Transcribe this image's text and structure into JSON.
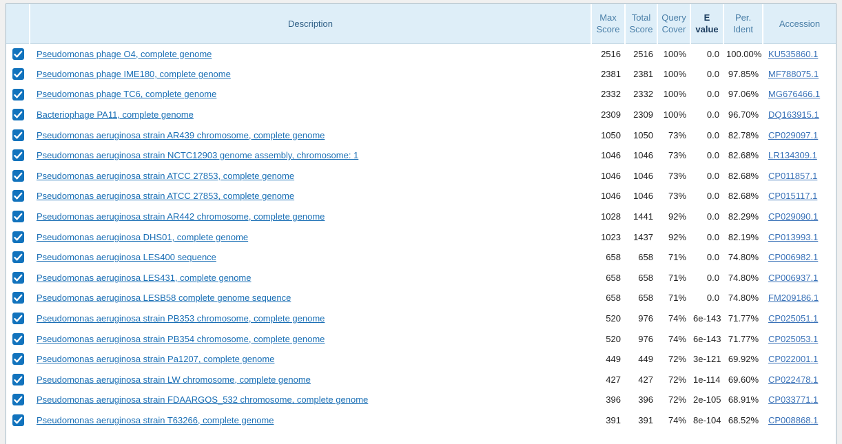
{
  "table": {
    "columns": [
      {
        "id": "checkbox",
        "label": "",
        "label2": "",
        "sorted": false
      },
      {
        "id": "description",
        "label": "Description",
        "label2": "",
        "sorted": false
      },
      {
        "id": "max_score",
        "label": "Max",
        "label2": "Score",
        "sorted": false
      },
      {
        "id": "total_score",
        "label": "Total",
        "label2": "Score",
        "sorted": false
      },
      {
        "id": "query_cover",
        "label": "Query",
        "label2": "Cover",
        "sorted": false
      },
      {
        "id": "e_value",
        "label": "E",
        "label2": "value",
        "sorted": true
      },
      {
        "id": "per_ident",
        "label": "Per.",
        "label2": "Ident",
        "sorted": false
      },
      {
        "id": "accession",
        "label": "Accession",
        "label2": "",
        "sorted": false
      }
    ],
    "rows": [
      {
        "checked": true,
        "description": "Pseudomonas phage O4, complete genome",
        "max_score": "2516",
        "total_score": "2516",
        "query_cover": "100%",
        "e_value": "0.0",
        "per_ident": "100.00%",
        "accession": "KU535860.1"
      },
      {
        "checked": true,
        "description": "Pseudomonas phage IME180, complete genome",
        "max_score": "2381",
        "total_score": "2381",
        "query_cover": "100%",
        "e_value": "0.0",
        "per_ident": "97.85%",
        "accession": "MF788075.1"
      },
      {
        "checked": true,
        "description": "Pseudomonas phage TC6, complete genome",
        "max_score": "2332",
        "total_score": "2332",
        "query_cover": "100%",
        "e_value": "0.0",
        "per_ident": "97.06%",
        "accession": "MG676466.1"
      },
      {
        "checked": true,
        "description": "Bacteriophage PA11, complete genome",
        "max_score": "2309",
        "total_score": "2309",
        "query_cover": "100%",
        "e_value": "0.0",
        "per_ident": "96.70%",
        "accession": "DQ163915.1"
      },
      {
        "checked": true,
        "description": "Pseudomonas aeruginosa strain AR439 chromosome, complete genome",
        "max_score": "1050",
        "total_score": "1050",
        "query_cover": "73%",
        "e_value": "0.0",
        "per_ident": "82.78%",
        "accession": "CP029097.1"
      },
      {
        "checked": true,
        "description": "Pseudomonas aeruginosa strain NCTC12903 genome assembly, chromosome: 1",
        "max_score": "1046",
        "total_score": "1046",
        "query_cover": "73%",
        "e_value": "0.0",
        "per_ident": "82.68%",
        "accession": "LR134309.1"
      },
      {
        "checked": true,
        "description": "Pseudomonas aeruginosa strain ATCC 27853, complete genome",
        "max_score": "1046",
        "total_score": "1046",
        "query_cover": "73%",
        "e_value": "0.0",
        "per_ident": "82.68%",
        "accession": "CP011857.1"
      },
      {
        "checked": true,
        "description": "Pseudomonas aeruginosa strain ATCC 27853, complete genome",
        "max_score": "1046",
        "total_score": "1046",
        "query_cover": "73%",
        "e_value": "0.0",
        "per_ident": "82.68%",
        "accession": "CP015117.1"
      },
      {
        "checked": true,
        "description": "Pseudomonas aeruginosa strain AR442 chromosome, complete genome",
        "max_score": "1028",
        "total_score": "1441",
        "query_cover": "92%",
        "e_value": "0.0",
        "per_ident": "82.29%",
        "accession": "CP029090.1"
      },
      {
        "checked": true,
        "description": "Pseudomonas aeruginosa DHS01, complete genome",
        "max_score": "1023",
        "total_score": "1437",
        "query_cover": "92%",
        "e_value": "0.0",
        "per_ident": "82.19%",
        "accession": "CP013993.1"
      },
      {
        "checked": true,
        "description": "Pseudomonas aeruginosa LES400 sequence",
        "max_score": "658",
        "total_score": "658",
        "query_cover": "71%",
        "e_value": "0.0",
        "per_ident": "74.80%",
        "accession": "CP006982.1"
      },
      {
        "checked": true,
        "description": "Pseudomonas aeruginosa LES431, complete genome",
        "max_score": "658",
        "total_score": "658",
        "query_cover": "71%",
        "e_value": "0.0",
        "per_ident": "74.80%",
        "accession": "CP006937.1"
      },
      {
        "checked": true,
        "description": "Pseudomonas aeruginosa LESB58 complete genome sequence",
        "max_score": "658",
        "total_score": "658",
        "query_cover": "71%",
        "e_value": "0.0",
        "per_ident": "74.80%",
        "accession": "FM209186.1"
      },
      {
        "checked": true,
        "description": "Pseudomonas aeruginosa strain PB353 chromosome, complete genome",
        "max_score": "520",
        "total_score": "976",
        "query_cover": "74%",
        "e_value": "6e-143",
        "per_ident": "71.77%",
        "accession": "CP025051.1"
      },
      {
        "checked": true,
        "description": "Pseudomonas aeruginosa strain PB354 chromosome, complete genome",
        "max_score": "520",
        "total_score": "976",
        "query_cover": "74%",
        "e_value": "6e-143",
        "per_ident": "71.77%",
        "accession": "CP025053.1"
      },
      {
        "checked": true,
        "description": "Pseudomonas aeruginosa strain Pa1207, complete genome",
        "max_score": "449",
        "total_score": "449",
        "query_cover": "72%",
        "e_value": "3e-121",
        "per_ident": "69.92%",
        "accession": "CP022001.1"
      },
      {
        "checked": true,
        "description": "Pseudomonas aeruginosa strain LW chromosome, complete genome",
        "max_score": "427",
        "total_score": "427",
        "query_cover": "72%",
        "e_value": "1e-114",
        "per_ident": "69.60%",
        "accession": "CP022478.1"
      },
      {
        "checked": true,
        "description": "Pseudomonas aeruginosa strain FDAARGOS_532 chromosome, complete genome",
        "max_score": "396",
        "total_score": "396",
        "query_cover": "72%",
        "e_value": "2e-105",
        "per_ident": "68.91%",
        "accession": "CP033771.1"
      },
      {
        "checked": true,
        "description": "Pseudomonas aeruginosa strain T63266, complete genome",
        "max_score": "391",
        "total_score": "391",
        "query_cover": "74%",
        "e_value": "8e-104",
        "per_ident": "68.52%",
        "accession": "CP008868.1"
      }
    ]
  },
  "colors": {
    "header_bg": "#deeef8",
    "header_text": "#4a7fa8",
    "header_sorted_text": "#1b3c5e",
    "link": "#1a6fb5",
    "accession_link": "#3a72b8",
    "checkbox": "#1273bd",
    "table_border": "#a6bcc9",
    "page_bg": "#f0f0f0"
  },
  "icons": {
    "checkbox_checked": "check-icon"
  }
}
